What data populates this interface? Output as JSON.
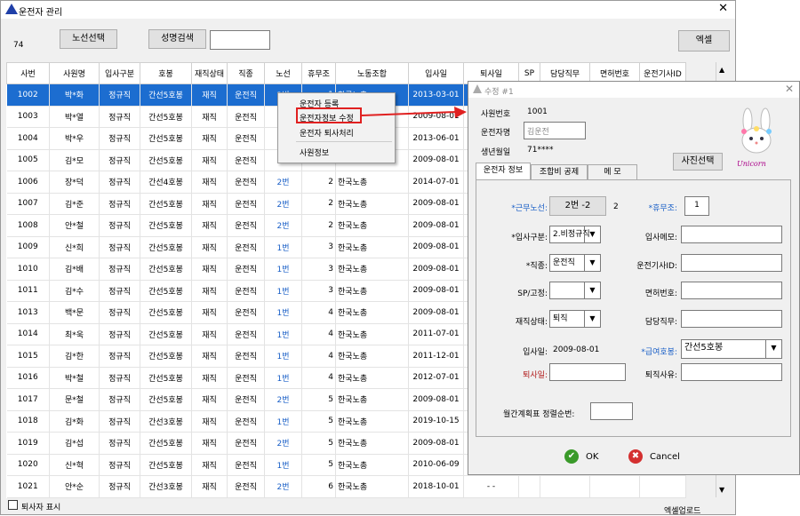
{
  "window": {
    "title": "운전자 관리",
    "close": "✕"
  },
  "toolbar": {
    "count": "74",
    "route_select": "노선선택",
    "name_search": "성명검색",
    "name_search_value": "",
    "excel": "엑셀"
  },
  "grid": {
    "columns": [
      "사번",
      "사원명",
      "입사구분",
      "호봉",
      "재직상태",
      "직종",
      "노선",
      "휴무조",
      "노동조합",
      "입사일",
      "퇴사일",
      "SP",
      "담당직무",
      "면허번호",
      "운전기사ID"
    ],
    "rows": [
      [
        "1002",
        "박*화",
        "정규직",
        "간선5호봉",
        "재직",
        "운전직",
        "2번",
        "1",
        "한국노총",
        "2013-03-01",
        "",
        "",
        "",
        "",
        ""
      ],
      [
        "1003",
        "박*열",
        "정규직",
        "간선5호봉",
        "재직",
        "운전직",
        "",
        "",
        "",
        "2009-08-01",
        "",
        "",
        "",
        "",
        ""
      ],
      [
        "1004",
        "박*우",
        "정규직",
        "간선5호봉",
        "재직",
        "운전직",
        "",
        "",
        "",
        "2013-06-01",
        "",
        "",
        "",
        "",
        ""
      ],
      [
        "1005",
        "김*모",
        "정규직",
        "간선5호봉",
        "재직",
        "운전직",
        "",
        "",
        "",
        "2009-08-01",
        "",
        "",
        "",
        "",
        ""
      ],
      [
        "1006",
        "장*덕",
        "정규직",
        "간선4호봉",
        "재직",
        "운전직",
        "2번",
        "2",
        "한국노총",
        "2014-07-01",
        "",
        "",
        "",
        "",
        ""
      ],
      [
        "1007",
        "김*준",
        "정규직",
        "간선5호봉",
        "재직",
        "운전직",
        "2번",
        "2",
        "한국노총",
        "2009-08-01",
        "",
        "",
        "",
        "",
        ""
      ],
      [
        "1008",
        "안*철",
        "정규직",
        "간선5호봉",
        "재직",
        "운전직",
        "2번",
        "2",
        "한국노총",
        "2009-08-01",
        "",
        "",
        "",
        "",
        ""
      ],
      [
        "1009",
        "신*희",
        "정규직",
        "간선5호봉",
        "재직",
        "운전직",
        "1번",
        "3",
        "한국노총",
        "2009-08-01",
        "",
        "",
        "",
        "",
        ""
      ],
      [
        "1010",
        "김*배",
        "정규직",
        "간선5호봉",
        "재직",
        "운전직",
        "1번",
        "3",
        "한국노총",
        "2009-08-01",
        "",
        "",
        "",
        "",
        ""
      ],
      [
        "1011",
        "김*수",
        "정규직",
        "간선5호봉",
        "재직",
        "운전직",
        "1번",
        "3",
        "한국노총",
        "2009-08-01",
        "",
        "",
        "",
        "",
        ""
      ],
      [
        "1013",
        "백*문",
        "정규직",
        "간선5호봉",
        "재직",
        "운전직",
        "1번",
        "4",
        "한국노총",
        "2009-08-01",
        "",
        "",
        "",
        "",
        ""
      ],
      [
        "1014",
        "최*욱",
        "정규직",
        "간선5호봉",
        "재직",
        "운전직",
        "1번",
        "4",
        "한국노총",
        "2011-07-01",
        "",
        "",
        "",
        "",
        ""
      ],
      [
        "1015",
        "김*한",
        "정규직",
        "간선5호봉",
        "재직",
        "운전직",
        "1번",
        "4",
        "한국노총",
        "2011-12-01",
        "",
        "",
        "",
        "",
        ""
      ],
      [
        "1016",
        "박*철",
        "정규직",
        "간선5호봉",
        "재직",
        "운전직",
        "1번",
        "4",
        "한국노총",
        "2012-07-01",
        "",
        "",
        "",
        "",
        ""
      ],
      [
        "1017",
        "문*철",
        "정규직",
        "간선5호봉",
        "재직",
        "운전직",
        "2번",
        "5",
        "한국노총",
        "2009-08-01",
        "",
        "",
        "",
        "",
        ""
      ],
      [
        "1018",
        "김*화",
        "정규직",
        "간선3호봉",
        "재직",
        "운전직",
        "1번",
        "5",
        "한국노총",
        "2019-10-15",
        "",
        "",
        "",
        "",
        ""
      ],
      [
        "1019",
        "김*섭",
        "정규직",
        "간선5호봉",
        "재직",
        "운전직",
        "2번",
        "5",
        "한국노총",
        "2009-08-01",
        "",
        "",
        "",
        "",
        ""
      ],
      [
        "1020",
        "신*혁",
        "정규직",
        "간선5호봉",
        "재직",
        "운전직",
        "1번",
        "5",
        "한국노총",
        "2010-06-09",
        "",
        "",
        "",
        "",
        ""
      ],
      [
        "1021",
        "안*순",
        "정규직",
        "간선3호봉",
        "재직",
        "운전직",
        "2번",
        "6",
        "한국노총",
        "2018-10-01",
        "- -",
        "",
        "",
        "",
        ""
      ]
    ]
  },
  "context_menu": {
    "items": [
      "운전자 등록",
      "운전자정보 수정",
      "운전자 퇴사처리",
      "사원정보"
    ]
  },
  "footer": {
    "show_retired": "퇴사자 표시",
    "excel_upload": "엑셀업로드"
  },
  "dialog": {
    "title": "수정 #1",
    "emp_no_label": "사원번호",
    "emp_no": "1001",
    "name_label": "운전자명",
    "name": "김운전",
    "birth_label": "생년월일",
    "birth": "71****",
    "photo_button": "사진선택",
    "photo_caption": "Unicorn",
    "tabs": [
      "운전자 정보",
      "조합비 공제",
      "메 모"
    ],
    "route_label": "*근무노선:",
    "route_value": "2번 -2",
    "route_extra": "2",
    "rest_label": "*휴무조:",
    "rest_value": "1",
    "hire_type_label": "*입사구분:",
    "hire_type_value": "2.비정규직",
    "hire_memo_label": "입사메모:",
    "hire_memo": "",
    "job_label": "*직종:",
    "job_value": "운전직",
    "driver_id_label": "운전기사ID:",
    "driver_id": "",
    "sp_label": "SP/고정:",
    "sp_value": "",
    "license_label": "면허번호:",
    "license": "",
    "status_label": "재직상태:",
    "status_value": "퇴직",
    "duty_label": "담당직무:",
    "duty": "",
    "hire_date_label": "입사일:",
    "hire_date": "2009-08-01",
    "pay_grade_label": "*급여호봉:",
    "pay_grade_value": "간선5호봉",
    "retire_date_label": "퇴사일:",
    "retire_date": "",
    "retire_reason_label": "퇴직사유:",
    "retire_reason": "",
    "monthly_order_label": "월간계획표 정렬순번:",
    "monthly_order": "",
    "ok": "OK",
    "cancel": "Cancel"
  },
  "colors": {
    "selection": "#1c6dd0",
    "link_blue": "#1a5fc7",
    "arrow_red": "#e02020"
  }
}
